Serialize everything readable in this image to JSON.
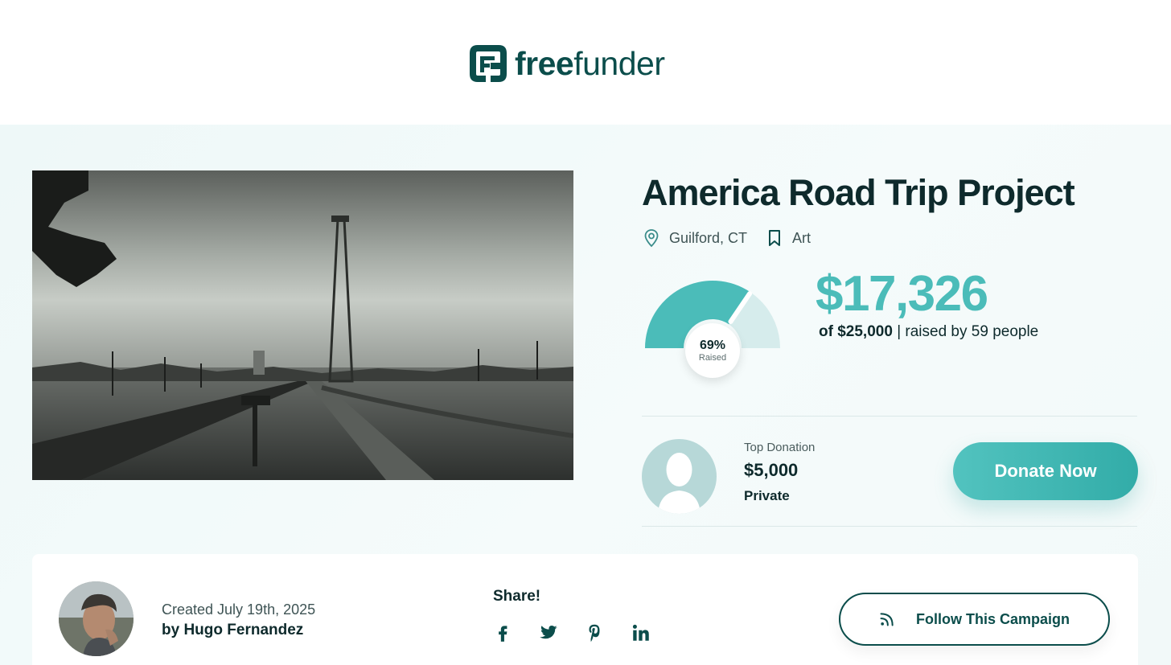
{
  "brand": {
    "logo_bold": "free",
    "logo_regular": "funder",
    "color": "#0b4d4b",
    "accent": "#4bbcb9"
  },
  "campaign": {
    "title": "America Road Trip Project",
    "location": "Guilford, CT",
    "category": "Art",
    "amount_raised": "$17,326",
    "goal": "of $25,000",
    "supporters": "| raised by 59 people",
    "percent_raised": 0.69,
    "percent_label": "69%",
    "percent_caption": "Raised"
  },
  "top_donation": {
    "label": "Top Donation",
    "amount": "$5,000",
    "donor": "Private"
  },
  "donate_button": {
    "label": "Donate Now"
  },
  "creator": {
    "created": "Created July 19th, 2025",
    "byline": "by Hugo Fernandez"
  },
  "share": {
    "label": "Share!",
    "icons": [
      "facebook-icon",
      "twitter-icon",
      "pinterest-icon",
      "linkedin-icon"
    ]
  },
  "follow_button": {
    "label": "Follow This Campaign",
    "icon": "rss-icon"
  }
}
